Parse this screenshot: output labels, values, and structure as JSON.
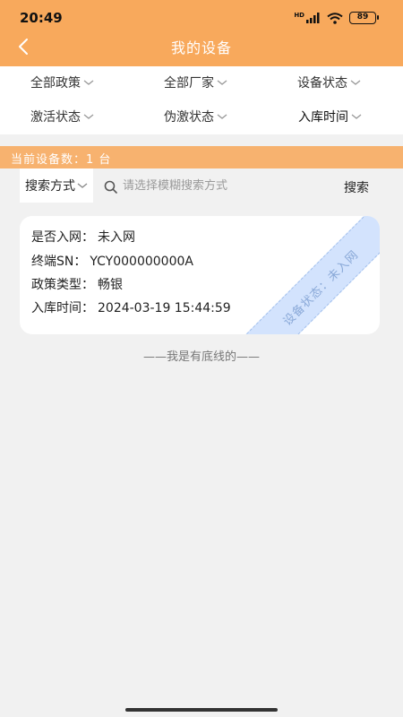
{
  "status_bar": {
    "time": "20:49",
    "battery": "89",
    "network_label": "HD"
  },
  "header": {
    "title": "我的设备"
  },
  "filters": [
    {
      "label": "全部政策"
    },
    {
      "label": "全部厂家"
    },
    {
      "label": "设备状态"
    },
    {
      "label": "激活状态"
    },
    {
      "label": "伪激状态"
    },
    {
      "label": "入库时间"
    }
  ],
  "device_count": {
    "text": "当前设备数：1 台"
  },
  "search": {
    "mode_label": "搜索方式",
    "placeholder": "请选择模糊搜索方式",
    "button_label": "搜索"
  },
  "devices": [
    {
      "network_label": "是否入网：",
      "network_value": "未入网",
      "sn_label": "终端SN：",
      "sn_value": "YCY000000000A",
      "policy_label": "政策类型：",
      "policy_value": "畅银",
      "time_label": "入库时间：",
      "time_value": "2024-03-19 15:44:59",
      "status_stamp": "设备状态：未入网"
    }
  ],
  "footer": {
    "text": "——我是有底线的——"
  },
  "colors": {
    "header_bg": "#f8a95c",
    "count_bar_bg": "#f7b26f",
    "stamp_bg": "#d3e3fd"
  }
}
